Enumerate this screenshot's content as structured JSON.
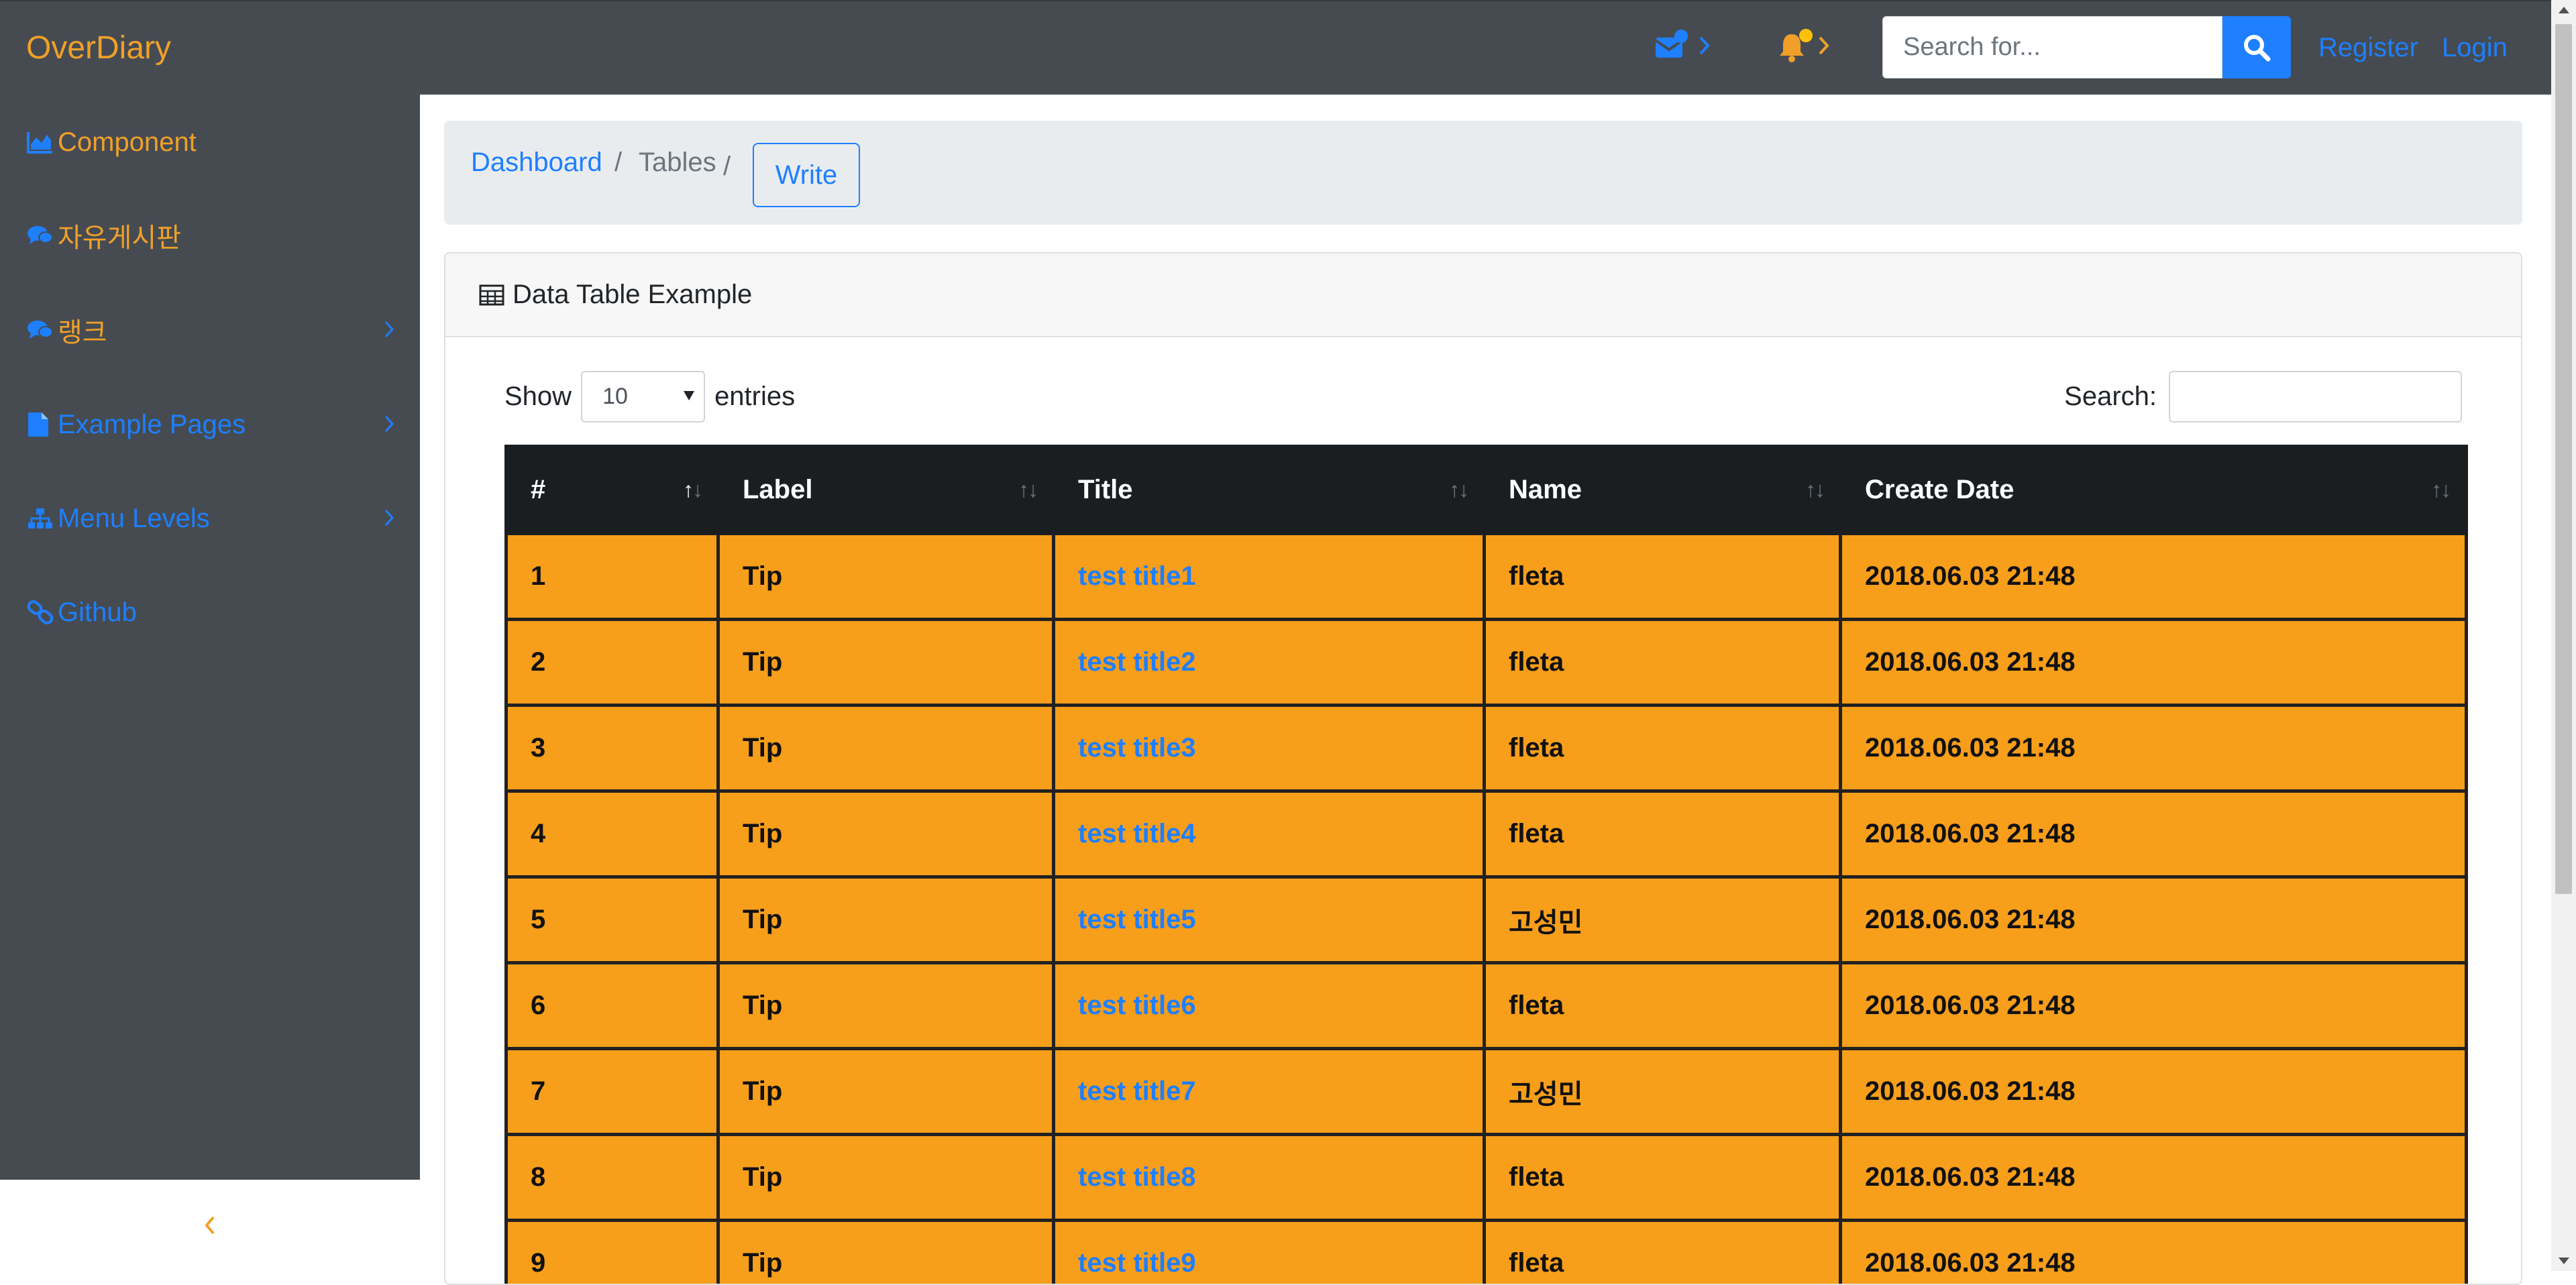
{
  "navbar": {
    "brand": "OverDiary",
    "search_placeholder": "Search for...",
    "register_label": "Register",
    "login_label": "Login"
  },
  "sidebar": {
    "items": [
      {
        "label": "Component",
        "icon": "area-chart-icon",
        "color": "#f0a029"
      },
      {
        "label": "자유게시판",
        "icon": "comments-icon",
        "color": "#f0a029"
      },
      {
        "label": "랭크",
        "icon": "comments-icon",
        "color": "#f0a029"
      },
      {
        "label": "Example Pages",
        "icon": "file-icon",
        "color": "#1e7fff"
      },
      {
        "label": "Menu Levels",
        "icon": "sitemap-icon",
        "color": "#1e7fff"
      },
      {
        "label": "Github",
        "icon": "link-icon",
        "color": "#1e7fff"
      }
    ]
  },
  "breadcrumb": {
    "dashboard": "Dashboard",
    "sep1": "/",
    "tables": "Tables",
    "sep2": "/",
    "write": "Write"
  },
  "card": {
    "title": "Data Table Example",
    "show_label": "Show",
    "length_value": "10",
    "entries_label": "entries",
    "search_label": "Search:"
  },
  "table": {
    "headers": [
      "#",
      "Label",
      "Title",
      "Name",
      "Create Date"
    ],
    "rows": [
      {
        "num": "1",
        "label": "Tip",
        "title": "test title1",
        "name": "fleta",
        "date": "2018.06.03 21:48"
      },
      {
        "num": "2",
        "label": "Tip",
        "title": "test title2",
        "name": "fleta",
        "date": "2018.06.03 21:48"
      },
      {
        "num": "3",
        "label": "Tip",
        "title": "test title3",
        "name": "fleta",
        "date": "2018.06.03 21:48"
      },
      {
        "num": "4",
        "label": "Tip",
        "title": "test title4",
        "name": "fleta",
        "date": "2018.06.03 21:48"
      },
      {
        "num": "5",
        "label": "Tip",
        "title": "test title5",
        "name": "고성민",
        "date": "2018.06.03 21:48"
      },
      {
        "num": "6",
        "label": "Tip",
        "title": "test title6",
        "name": "fleta",
        "date": "2018.06.03 21:48"
      },
      {
        "num": "7",
        "label": "Tip",
        "title": "test title7",
        "name": "고성민",
        "date": "2018.06.03 21:48"
      },
      {
        "num": "8",
        "label": "Tip",
        "title": "test title8",
        "name": "fleta",
        "date": "2018.06.03 21:48"
      },
      {
        "num": "9",
        "label": "Tip",
        "title": "test title9",
        "name": "fleta",
        "date": "2018.06.03 21:48"
      }
    ]
  },
  "colors": {
    "brand": "#f0a029",
    "primary": "#1e7fff",
    "navbar_bg": "#454b51",
    "row_bg": "#f79e1b",
    "header_bg": "#1b1e21",
    "message_dot": "#1e7fff",
    "bell_dot": "#ffc107"
  }
}
